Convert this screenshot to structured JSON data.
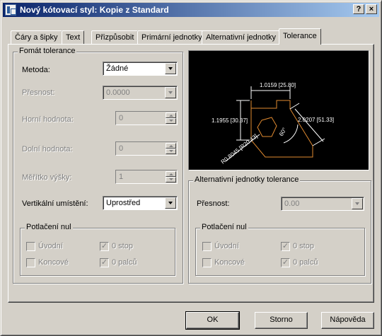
{
  "window": {
    "title": "Nový kótovací styl: Kopie z Standard",
    "help_button": "?",
    "close_button": "×"
  },
  "tabs": [
    {
      "label": "Čáry a šipky"
    },
    {
      "label": "Text"
    },
    {
      "label": "Přizpůsobit"
    },
    {
      "label": "Primární jednotky"
    },
    {
      "label": "Alternativní jednotky"
    },
    {
      "label": "Tolerance"
    }
  ],
  "format": {
    "group_label": "Fomát tolerance",
    "method_label": "Metoda:",
    "method_value": "Žádné",
    "precision_label": "Přesnost:",
    "precision_value": "0.0000",
    "upper_label": "Horní hodnota:",
    "upper_value": "0",
    "lower_label": "Dolní hodnota:",
    "lower_value": "0",
    "scale_label": "Měřítko výšky:",
    "scale_value": "1",
    "vpos_label": "Vertikální umístění:",
    "vpos_value": "Uprostřed"
  },
  "zero_left": {
    "group_label": "Potlačení nul",
    "leading": "Úvodní",
    "trailing": "Koncové",
    "zero_feet": "0 stop",
    "zero_inches": "0 palců"
  },
  "alt": {
    "group_label": "Alternativní jednotky tolerance",
    "precision_label": "Přesnost:",
    "precision_value": "0.00"
  },
  "zero_right": {
    "group_label": "Potlačení nul",
    "leading": "Úvodní",
    "trailing": "Koncové",
    "zero_feet": "0 stop",
    "zero_inches": "0 palců"
  },
  "preview": {
    "dim_top": "1.0159 [25.80]",
    "dim_left": "1.1955 [30.37]",
    "dim_right": "2.0207 [51.33]",
    "dim_angle": "60°",
    "dim_radius": "R0.8045 [R20.43]",
    "colors": {
      "geometry": "#e08a30",
      "dims": "#ffffff"
    }
  },
  "buttons": {
    "ok": "OK",
    "cancel": "Storno",
    "help": "Nápověda"
  }
}
